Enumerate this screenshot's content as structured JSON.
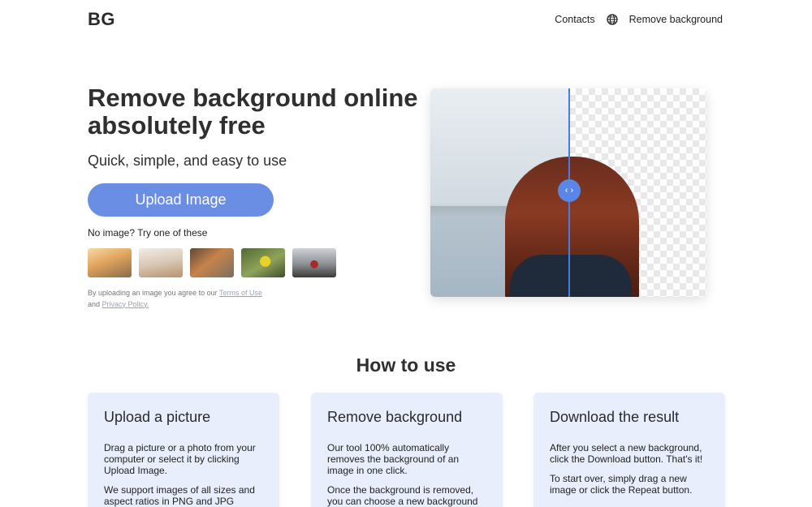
{
  "header": {
    "logo": "BG",
    "nav": {
      "contacts": "Contacts",
      "remove_background": "Remove background"
    }
  },
  "hero": {
    "title": "Remove background online absolutely free",
    "subtitle": "Quick, simple, and easy to use",
    "upload_button": "Upload Image",
    "try_label": "No image? Try one of these",
    "samples": [
      "dog-on-beach",
      "dog-waving",
      "cat-and-dog",
      "yellow-bird",
      "red-house"
    ],
    "legal_prefix": "By uploading an image you agree to our",
    "terms_link": "Terms of Use",
    "legal_and": "and",
    "privacy_link": "Privacy Policy."
  },
  "demo": {
    "handle_icon": "‹ ›",
    "divider_color": "#4a7be0"
  },
  "how_to_use": {
    "title": "How to use",
    "cards": [
      {
        "title": "Upload a picture",
        "paragraphs": [
          "Drag a picture or a photo from your computer or select it by clicking Upload Image.",
          "We support images of all sizes and aspect ratios in PNG and JPG formats."
        ]
      },
      {
        "title": "Remove background",
        "paragraphs": [
          "Our tool 100% automatically removes the background of an image in one click.",
          "Once the background is removed, you can choose a new background color or"
        ]
      },
      {
        "title": "Download the result",
        "paragraphs": [
          "After you select a new background, click the Download button. That's it!",
          "To start over, simply drag a new image or click the Repeat button."
        ]
      }
    ]
  },
  "colors": {
    "accent": "#6a8ee3",
    "card_bg": "#e8eefb"
  }
}
